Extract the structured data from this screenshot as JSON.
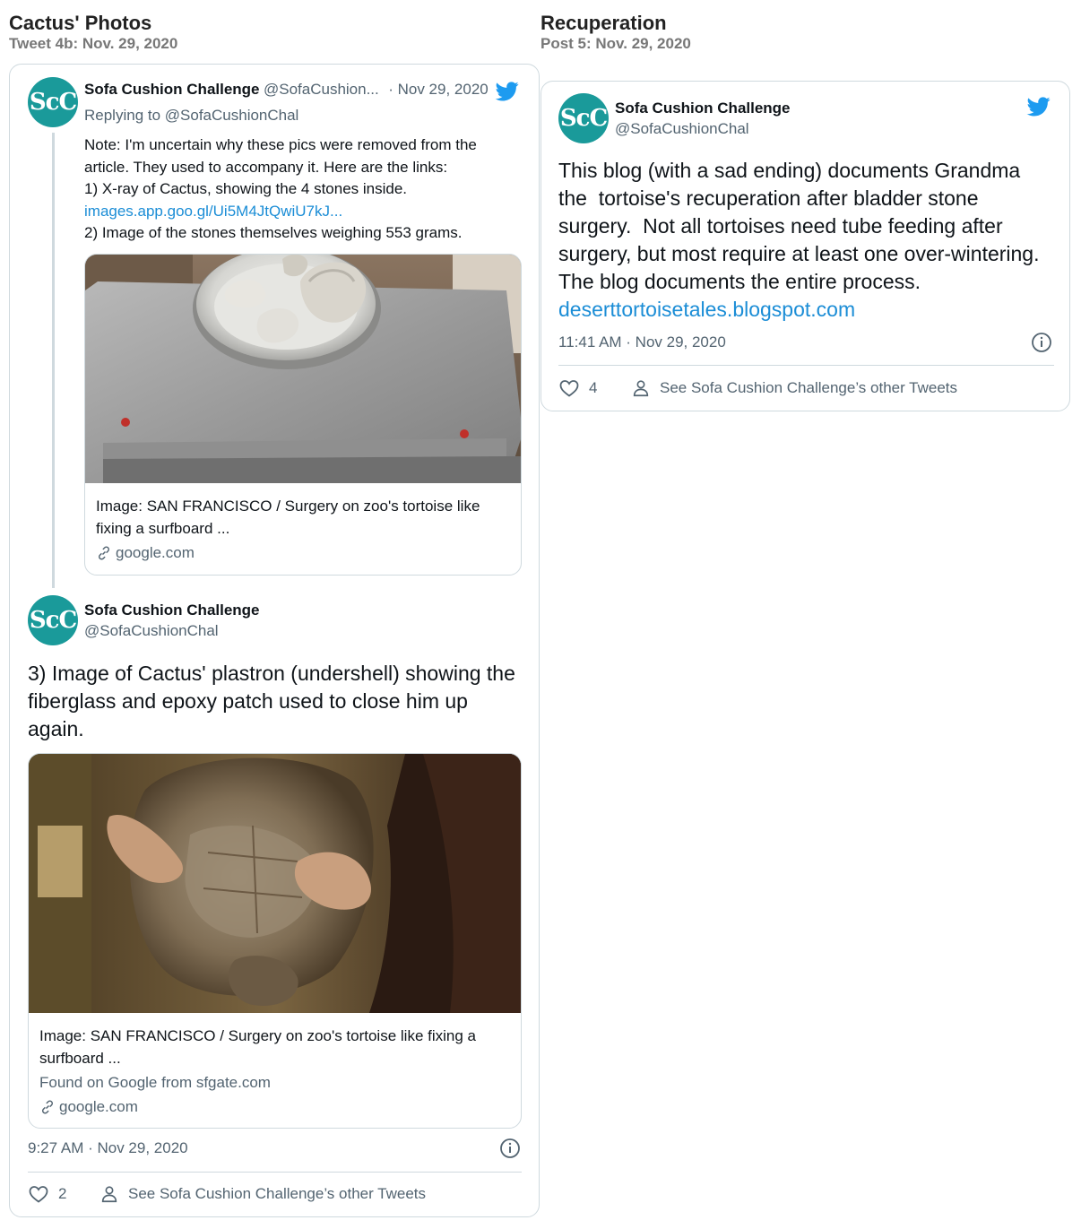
{
  "left_column": {
    "title": "Cactus' Photos",
    "subtitle": "Tweet 4b: Nov. 29, 2020"
  },
  "right_column": {
    "title": "Recuperation",
    "subtitle": "Post 5: Nov. 29, 2020"
  },
  "avatar_text": "ScC",
  "tweet1": {
    "name": "Sofa Cushion Challenge",
    "handle": "@SofaCushion...",
    "date": "· Nov 29, 2020",
    "replying": "Replying to @SofaCushionChal",
    "lines": [
      "Note: I'm uncertain why these pics were removed from the",
      "article.  They used to accompany it.  Here are the links:",
      "1) X-ray of Cactus, showing the 4 stones inside."
    ],
    "link": "images.app.goo.gl/Ui5M4JtQwiU7kJ...",
    "line_after": "2) Image of the stones themselves weighing 553 grams.",
    "embed": {
      "title": "Image: SAN FRANCISCO / Surgery on zoo's tortoise like fixing a surfboard ...",
      "domain": "google.com"
    }
  },
  "tweet2": {
    "name": "Sofa Cushion Challenge",
    "handle": "@SofaCushionChal",
    "text": "3) Image of Cactus' plastron (undershell) showing the fiberglass and epoxy patch used to close him up again.",
    "embed": {
      "title": "Image: SAN FRANCISCO / Surgery on zoo's tortoise like fixing a surfboard ...",
      "subtitle": "Found on Google from sfgate.com",
      "domain": "google.com"
    },
    "timestamp": "9:27 AM · Nov 29, 2020",
    "likes": "2",
    "see_other": "See Sofa Cushion Challenge’s other Tweets"
  },
  "tweet3": {
    "name": "Sofa Cushion Challenge",
    "handle": "@SofaCushionChal",
    "text": "This blog (with a sad ending) documents Grandma the  tortoise's recuperation after bladder stone surgery.  Not all tortoises need tube feeding after surgery, but most require at least one over-wintering.  The blog documents the entire process.",
    "link": "deserttortoisetales.blogspot.com",
    "timestamp": "11:41 AM · Nov 29, 2020",
    "likes": "4",
    "see_other": "See Sofa Cushion Challenge’s other Tweets"
  },
  "icons": {
    "twitter": "twitter-bird-icon",
    "info": "info-icon",
    "like": "heart-icon",
    "profile": "person-icon",
    "link": "link-icon"
  },
  "colors": {
    "twitter_blue": "#1d9bf0",
    "link_blue": "#1b8dd6",
    "avatar_teal": "#1a9a9a",
    "border": "#cfd9de",
    "muted_text": "#536471"
  }
}
